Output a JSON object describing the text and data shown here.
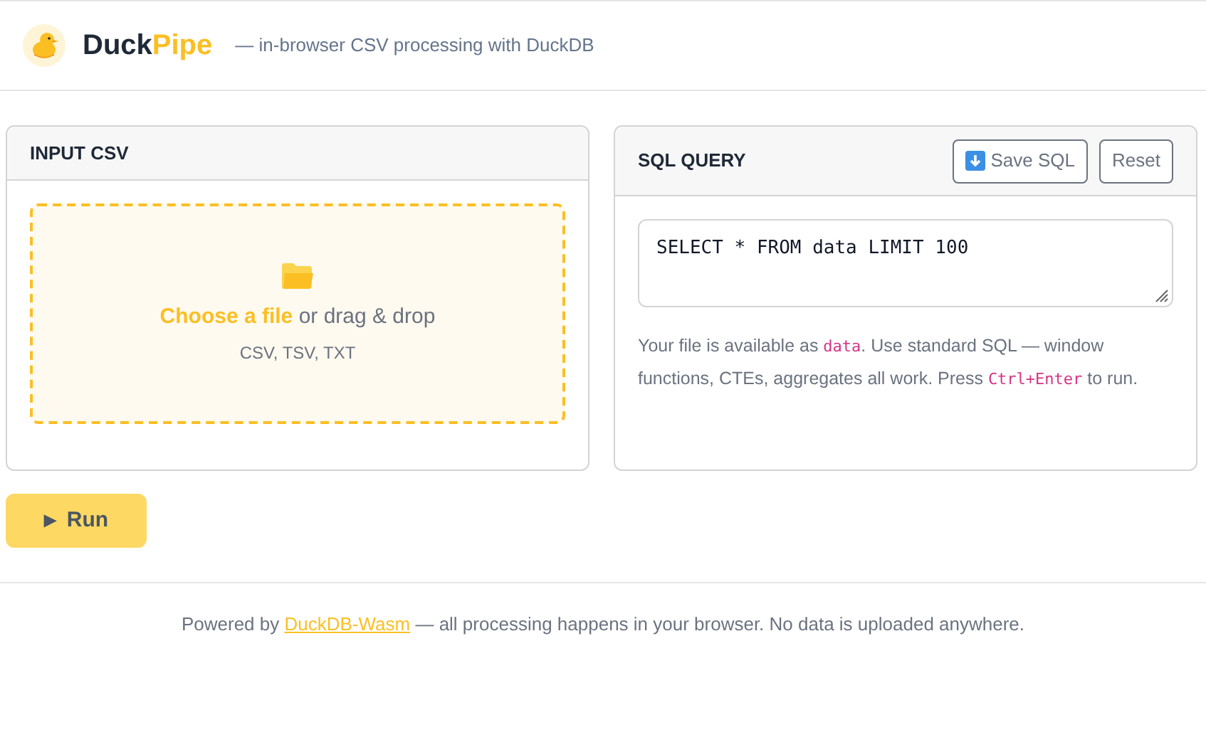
{
  "header": {
    "brand_part_1": "Duck",
    "brand_part_2": "Pipe",
    "tagline": "— in-browser CSV processing with DuckDB"
  },
  "input_panel": {
    "title": "INPUT CSV",
    "choose_link": "Choose a file",
    "drop_text": "or drag & drop",
    "formats": "CSV, TSV, TXT"
  },
  "sql_panel": {
    "title": "SQL QUERY",
    "buttons": [
      {
        "label": "Save SQL",
        "kind": "save"
      },
      {
        "label": "Reset",
        "kind": "plain"
      }
    ],
    "query": "SELECT * FROM data LIMIT 100",
    "hint": [
      {
        "kind": "text",
        "text": "Your file is available as "
      },
      {
        "kind": "code",
        "text": "data"
      },
      {
        "kind": "text",
        "text": ". Use standard SQL — window functions, CTEs, aggregates all work. Press "
      },
      {
        "kind": "code",
        "text": "Ctrl+Enter"
      },
      {
        "kind": "text",
        "text": " to run."
      }
    ]
  },
  "run_button": {
    "label": "Run",
    "icon": "▶"
  },
  "footer": [
    {
      "kind": "text",
      "text": "Powered by "
    },
    {
      "kind": "link",
      "text": "DuckDB-Wasm"
    },
    {
      "kind": "text",
      "text": " — all processing happens in your browser. No data is uploaded anywhere."
    }
  ]
}
